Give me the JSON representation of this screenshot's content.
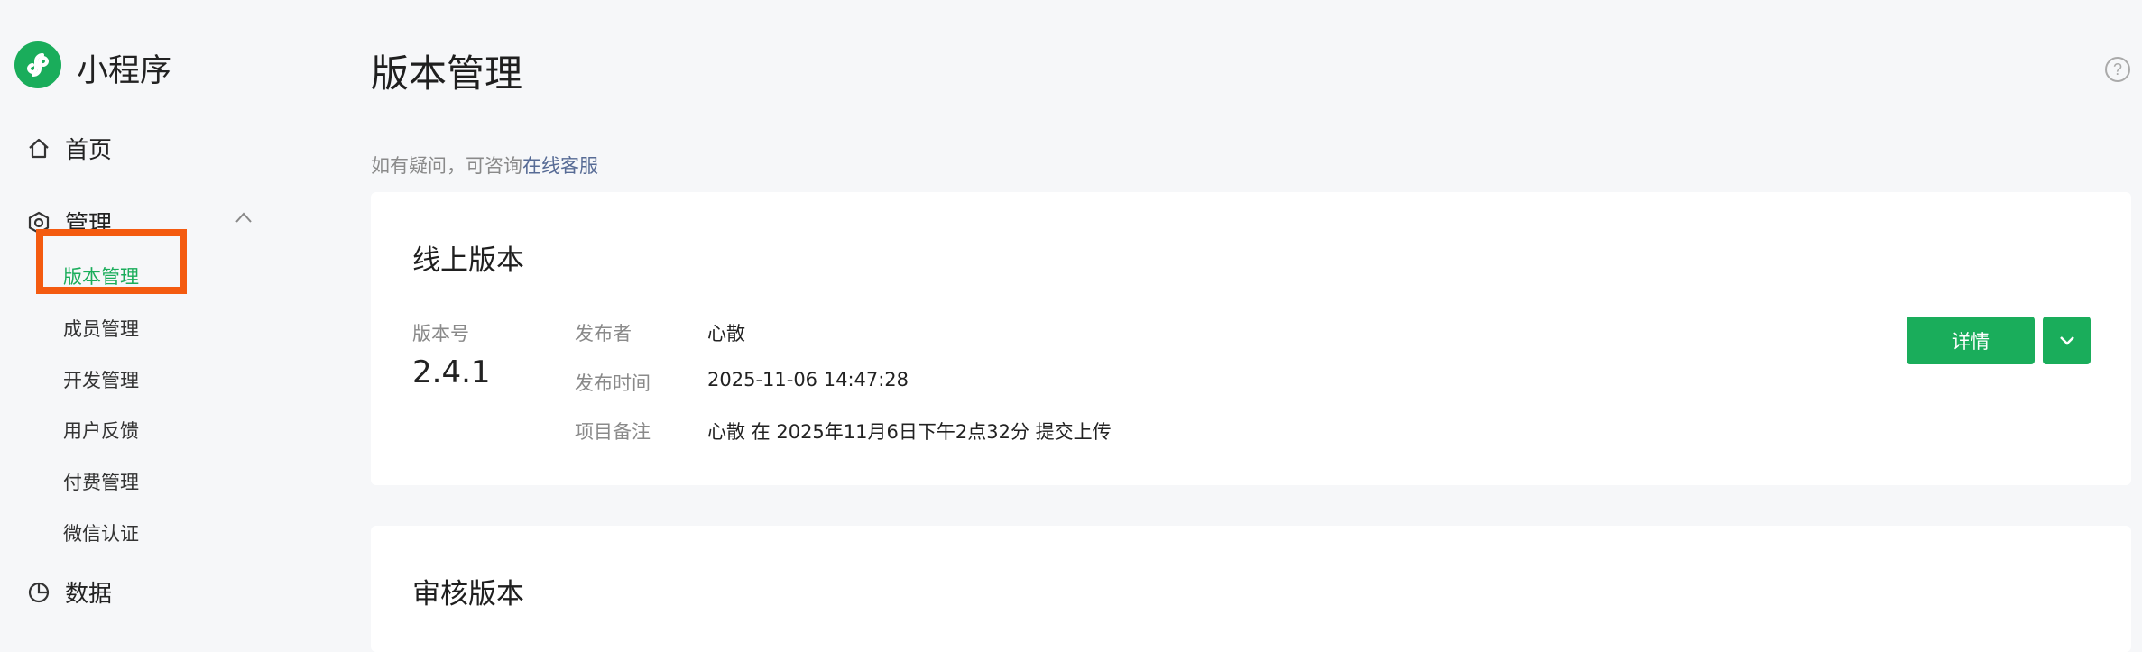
{
  "app": {
    "title": "小程序"
  },
  "sidebar": {
    "home": "首页",
    "manage": "管理",
    "sub_items": [
      "版本管理",
      "成员管理",
      "开发管理",
      "用户反馈",
      "付费管理",
      "微信认证"
    ],
    "data": "数据"
  },
  "page": {
    "title": "版本管理",
    "hint_prefix": "如有疑问，可咨询",
    "hint_link": "在线客服"
  },
  "online_version": {
    "title": "线上版本",
    "version_label": "版本号",
    "version": "2.4.1",
    "publisher_label": "发布者",
    "publisher": "心散",
    "time_label": "发布时间",
    "time": "2025-11-06 14:47:28",
    "note_label": "项目备注",
    "note": "心散 在 2025年11月6日下午2点32分 提交上传",
    "detail_button": "详情"
  },
  "review_version": {
    "title": "审核版本"
  },
  "colors": {
    "brand_green": "#1aad5b",
    "highlight_orange": "#f45b10",
    "link_blue": "#576b95"
  }
}
